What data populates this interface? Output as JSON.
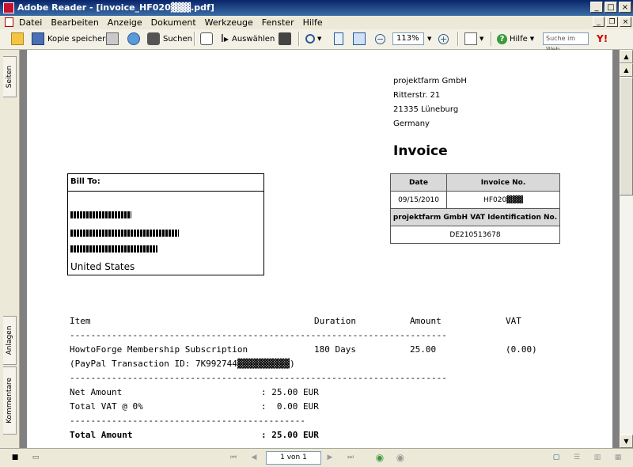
{
  "window": {
    "title": "Adobe Reader - [invoice_HF020▓▓▓.pdf]"
  },
  "menu": [
    "Datei",
    "Bearbeiten",
    "Anzeige",
    "Dokument",
    "Werkzeuge",
    "Fenster",
    "Hilfe"
  ],
  "toolbar": {
    "save_copy_label": "Kopie speichern",
    "search_label": "Suchen",
    "select_label": "Auswählen",
    "zoom_value": "113%",
    "help_label": "Hilfe",
    "web_search_placeholder": "Suche im Web"
  },
  "leftnav": {
    "tab_pages": "Seiten",
    "tab_attachments": "Anlagen",
    "tab_comments": "Kommentare"
  },
  "statusbar": {
    "page_indicator": "1 von 1"
  },
  "invoice": {
    "sender": {
      "company": "projektfarm GmbH",
      "street": "Ritterstr. 21",
      "city": "21335 Lüneburg",
      "country": "Germany"
    },
    "title": "Invoice",
    "bill_to_label": "Bill To:",
    "bill_to_country": "United States",
    "info_table": {
      "date_header": "Date",
      "invoice_no_header": "Invoice No.",
      "date": "09/15/2010",
      "invoice_no": "HF020▓▓▓",
      "vat_id_header": "projektfarm GmbH VAT Identification No.",
      "vat_id": "DE210513678"
    },
    "columns": {
      "item": "Item",
      "duration": "Duration",
      "amount": "Amount",
      "vat": "VAT"
    },
    "line_item": {
      "description": "HowtoForge Membership Subscription",
      "transaction": "(PayPal Transaction ID: 7K992744▓▓▓▓▓▓▓▓▓▓)",
      "duration": "180 Days",
      "amount": "25.00",
      "vat": "(0.00)"
    },
    "totals": {
      "net_label": "Net Amount",
      "net_value": ": 25.00 EUR",
      "vat_label": "Total VAT @ 0%",
      "vat_value": ":  0.00 EUR",
      "total_label": "Total Amount",
      "total_value": ": 25.00 EUR"
    },
    "rule_long": "------------------------------------------------------------------------",
    "rule_short": "---------------------------------------------"
  }
}
